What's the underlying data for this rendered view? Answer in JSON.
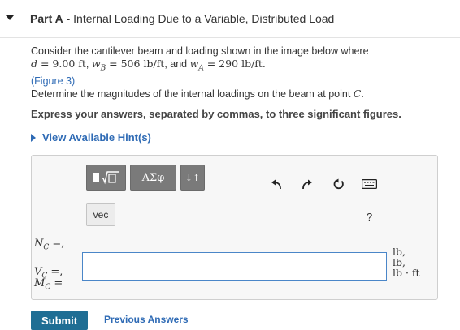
{
  "header": {
    "part_label": "Part A",
    "separator": " - ",
    "title": "Internal Loading Due to a Variable, Distributed Load"
  },
  "problem": {
    "line1": "Consider the cantilever beam and loading shown in the image below where",
    "d_expr": "d = 9.00 ft",
    "wb_expr": "wB = 506 lb/ft",
    "wa_expr": "wA = 290 lb/ft.",
    "and_text": "and",
    "figure_link": "(Figure 3)",
    "line3_prefix": "Determine the magnitudes of the internal loadings on the beam at point",
    "point": "C",
    "line3_suffix": "."
  },
  "instruction": "Express your answers, separated by commas, to three significant figures.",
  "hint": {
    "label": "View Available Hint(s)"
  },
  "answer": {
    "toolbar": {
      "templates_label": "templates",
      "symbols_label": "ΑΣφ",
      "arrows_label": "↓↑"
    },
    "vec_label": "vec",
    "help_label": "?",
    "labels": [
      {
        "sym": "N",
        "sub": "C",
        "suffix": " =,"
      },
      {
        "sym": "V",
        "sub": "C",
        "suffix": " =,"
      },
      {
        "sym": "M",
        "sub": "C",
        "suffix": " ="
      }
    ],
    "input_value": "",
    "units": [
      "lb,",
      "lb,",
      "lb · ft"
    ]
  },
  "actions": {
    "submit_label": "Submit",
    "previous_answers_label": "Previous Answers"
  }
}
